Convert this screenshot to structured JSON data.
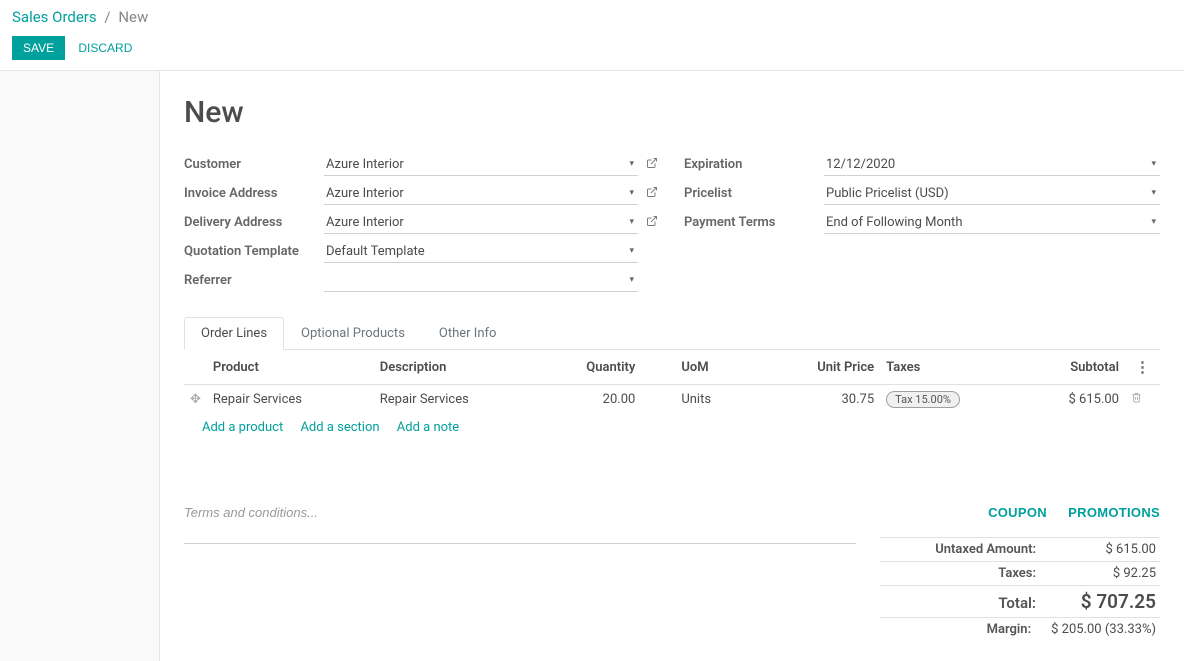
{
  "breadcrumb": {
    "parent": "Sales Orders",
    "current": "New"
  },
  "actions": {
    "save": "SAVE",
    "discard": "DISCARD"
  },
  "page_title": "New",
  "form_left": {
    "customer": {
      "label": "Customer",
      "value": "Azure Interior"
    },
    "invoice_address": {
      "label": "Invoice Address",
      "value": "Azure Interior"
    },
    "delivery_address": {
      "label": "Delivery Address",
      "value": "Azure Interior"
    },
    "quotation_template": {
      "label": "Quotation Template",
      "value": "Default Template"
    },
    "referrer": {
      "label": "Referrer",
      "value": ""
    }
  },
  "form_right": {
    "expiration": {
      "label": "Expiration",
      "value": "12/12/2020"
    },
    "pricelist": {
      "label": "Pricelist",
      "value": "Public Pricelist (USD)"
    },
    "payment_terms": {
      "label": "Payment Terms",
      "value": "End of Following Month"
    }
  },
  "tabs": {
    "order_lines": "Order Lines",
    "optional_products": "Optional Products",
    "other_info": "Other Info"
  },
  "table": {
    "headers": {
      "product": "Product",
      "description": "Description",
      "quantity": "Quantity",
      "uom": "UoM",
      "unit_price": "Unit Price",
      "taxes": "Taxes",
      "subtotal": "Subtotal"
    },
    "rows": [
      {
        "product": "Repair Services",
        "description": "Repair Services",
        "quantity": "20.00",
        "uom": "Units",
        "unit_price": "30.75",
        "tax": "Tax 15.00%",
        "subtotal": "$ 615.00"
      }
    ],
    "add_product": "Add a product",
    "add_section": "Add a section",
    "add_note": "Add a note"
  },
  "terms_placeholder": "Terms and conditions...",
  "promo": {
    "coupon": "COUPON",
    "promotions": "PROMOTIONS"
  },
  "totals": {
    "untaxed": {
      "label": "Untaxed Amount:",
      "value": "$ 615.00"
    },
    "taxes": {
      "label": "Taxes:",
      "value": "$ 92.25"
    },
    "total": {
      "label": "Total:",
      "value": "$ 707.25"
    },
    "margin": {
      "label": "Margin:",
      "value": "$ 205.00 (33.33%)"
    }
  }
}
